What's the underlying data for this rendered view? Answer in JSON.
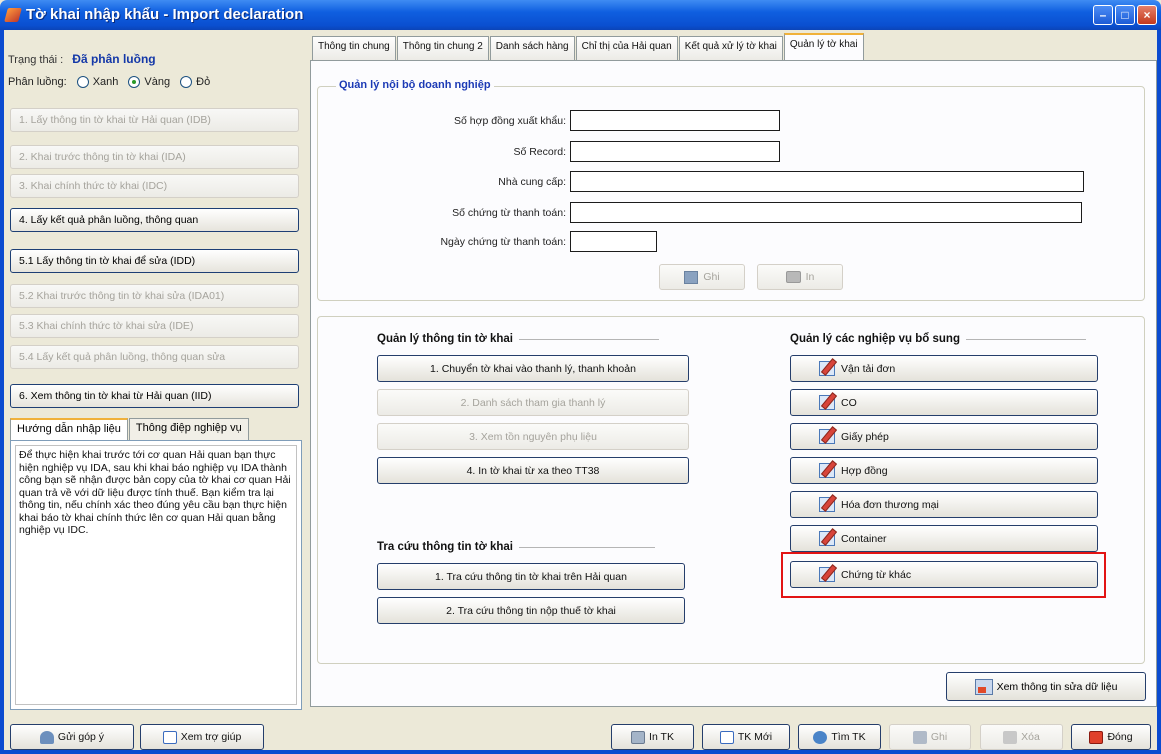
{
  "window": {
    "title": "Tờ khai nhập khẩu - Import declaration"
  },
  "left": {
    "status_label": "Trạng thái :",
    "status_value": "Đã phân luồng",
    "route_label": "Phân luồng:",
    "route_options": [
      "Xanh",
      "Vàng",
      "Đỏ"
    ],
    "route_selected": "Vàng",
    "buttons": [
      "1. Lấy thông tin tờ khai từ Hải quan (IDB)",
      "2. Khai trước thông tin tờ khai (IDA)",
      "3. Khai chính thức tờ khai (IDC)",
      "4. Lấy kết quả phân luồng, thông quan",
      "5.1 Lấy thông tin tờ khai để sửa (IDD)",
      "5.2 Khai trước thông tin tờ khai sửa (IDA01)",
      "5.3 Khai chính thức tờ khai sửa (IDE)",
      "5.4 Lấy kết quả phân luồng, thông quan sửa",
      "6. Xem thông tin tờ khai từ Hải quan (IID)"
    ],
    "guide_tabs": [
      "Hướng dẫn nhập liệu",
      "Thông điệp nghiệp vụ"
    ],
    "guide_text": "Để thực hiện khai trước tới cơ quan Hải quan bạn thực hiện nghiệp vụ IDA, sau khi khai báo nghiệp vụ IDA thành công bạn sẽ nhận được bản copy của tờ khai cơ quan Hải quan trả về với dữ liệu được tính thuế. Bạn kiểm tra lại thông tin, nếu chính xác theo đúng yêu cầu bạn thực hiện khai báo tờ khai chính thức lên cơ quan Hải quan bằng nghiệp vụ IDC."
  },
  "tabs": [
    "Thông tin chung",
    "Thông tin chung 2",
    "Danh sách hàng",
    "Chỉ thị của Hải quan",
    "Kết quả xử lý tờ khai",
    "Quản lý tờ khai"
  ],
  "active_tab": "Quản lý tờ khai",
  "internal": {
    "legend": "Quản lý nội bộ doanh nghiệp",
    "fields": [
      {
        "label": "Số hợp đồng xuất khẩu:",
        "value": ""
      },
      {
        "label": "Số Record:",
        "value": ""
      },
      {
        "label": "Nhà cung cấp:",
        "value": ""
      },
      {
        "label": "Số chứng từ thanh toán:",
        "value": ""
      },
      {
        "label": "Ngày chứng từ thanh toán:",
        "value": ""
      }
    ],
    "save_label": "Ghi",
    "print_label": "In"
  },
  "manage": {
    "title": "Quản lý thông tin tờ khai",
    "buttons": [
      "1. Chuyển tờ khai vào thanh lý, thanh khoản",
      "2. Danh sách tham gia thanh lý",
      "3. Xem tồn nguyên phụ liệu",
      "4. In tờ khai từ xa theo TT38"
    ]
  },
  "lookup": {
    "title": "Tra cứu thông tin tờ khai",
    "buttons": [
      "1. Tra cứu thông tin tờ khai trên Hải quan",
      "2. Tra cứu thông tin nộp thuế tờ khai"
    ]
  },
  "extra": {
    "title": "Quản lý các nghiệp vụ bổ sung",
    "buttons": [
      "Vận tải đơn",
      "CO",
      "Giấy phép",
      "Hợp đồng",
      "Hóa đơn thương mại",
      "Container",
      "Chứng từ khác"
    ]
  },
  "view_edit_label": "Xem thông tin sửa dữ liệu",
  "bottom": {
    "feedback": "Gửi góp ý",
    "help": "Xem trợ giúp",
    "print_tk": "In TK",
    "new_tk": "TK Mới",
    "find_tk": "Tìm TK",
    "save": "Ghi",
    "delete": "Xóa",
    "close": "Đóng"
  }
}
